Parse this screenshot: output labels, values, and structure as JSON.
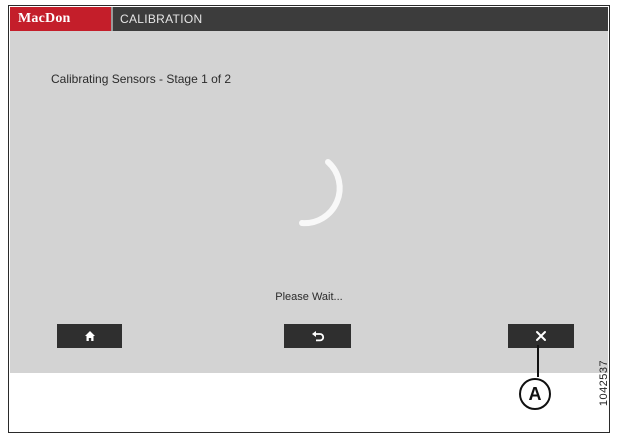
{
  "header": {
    "brand": "MacDon",
    "title": "CALIBRATION"
  },
  "main": {
    "status": "Calibrating Sensors - Stage 1 of 2",
    "wait_message": "Please Wait...",
    "spinner_icon": "loading-spinner-icon"
  },
  "buttons": {
    "home_icon": "home-icon",
    "back_icon": "back-arrow-icon",
    "close_icon": "close-icon"
  },
  "annotation": {
    "callout": "A",
    "figure_number": "1042537"
  },
  "colors": {
    "brand_red": "#c41e2a",
    "header_bg": "#3c3c3c",
    "screen_bg": "#d3d3d3",
    "button_bg": "#2f2f2f"
  }
}
